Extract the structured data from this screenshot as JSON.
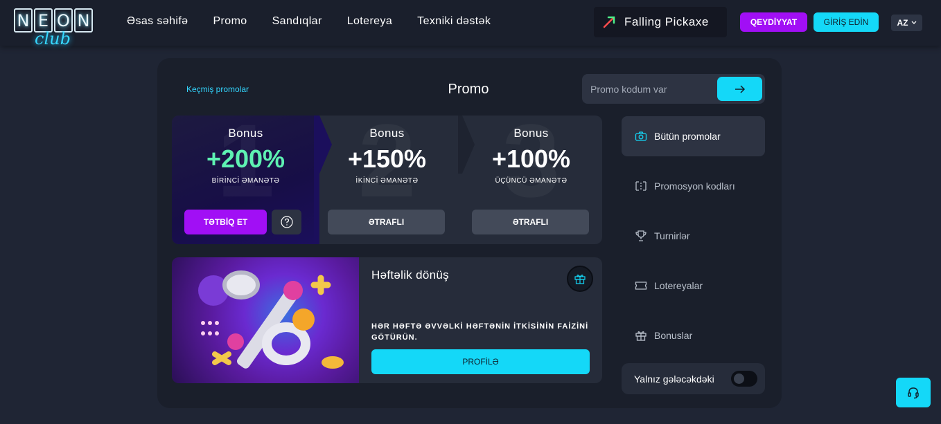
{
  "header": {
    "logo": {
      "letters": [
        "N",
        "E",
        "O",
        "N"
      ],
      "script": "club"
    },
    "nav": [
      "Əsas səhifə",
      "Promo",
      "Sandıqlar",
      "Lotereya",
      "Texniki dəstək"
    ],
    "game_badge": "Falling Pickaxe",
    "register_label": "QEYDİYYAT",
    "login_label": "GİRİŞ EDİN",
    "lang": "AZ"
  },
  "page": {
    "past_promos": "Keçmiş promolar",
    "title": "Promo",
    "promo_placeholder": "Promo kodum var"
  },
  "bonuses": [
    {
      "label": "Bonus",
      "pct": "+200%",
      "sub": "BİRİNCİ ƏMANƏTƏ",
      "num": "1",
      "button": "TƏTBİQ ET"
    },
    {
      "label": "Bonus",
      "pct": "+150%",
      "sub": "İKİNCİ ƏMANƏTƏ",
      "num": "2",
      "button": "ƏTRAFLI"
    },
    {
      "label": "Bonus",
      "pct": "+100%",
      "sub": "ÜÇÜNCÜ ƏMANƏTƏ",
      "num": "3",
      "button": "ƏTRAFLI"
    }
  ],
  "weekly": {
    "title": "Həftəlik dönüş",
    "description": "HƏR HƏFTƏ ƏVVƏLKİ HƏFTƏNİN İTKİSİNİN FAİZİNİ GÖTÜRÜN.",
    "button": "PROFİLƏ"
  },
  "sidebar": {
    "items": [
      {
        "label": "Bütün promolar",
        "icon": "camera-icon"
      },
      {
        "label": "Promosyon kodları",
        "icon": "promo-code-icon"
      },
      {
        "label": "Turnirlər",
        "icon": "trophy-icon"
      },
      {
        "label": "Lotereyalar",
        "icon": "ticket-icon"
      },
      {
        "label": "Bonuslar",
        "icon": "gift-icon"
      }
    ],
    "toggle_label": "Yalnız gələcəkdəki",
    "toggle_on": false
  },
  "colors": {
    "accent_cyan": "#14d8f8",
    "accent_purple": "#a10ff5",
    "green": "#5ef2b2",
    "bg": "#1f2534"
  }
}
